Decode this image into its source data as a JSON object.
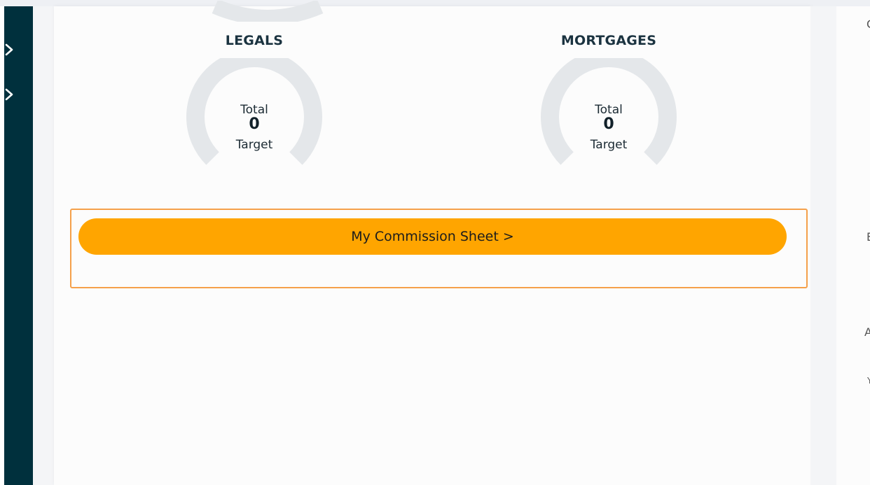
{
  "sidebar": {
    "items": [
      {
        "icon": "chevron-right-icon"
      },
      {
        "icon": "chevron-right-icon"
      }
    ]
  },
  "gauges": [
    {
      "title": "LEGALS",
      "total_label": "Total",
      "value": "0",
      "target_label": "Target",
      "progress": 0
    },
    {
      "title": "MORTGAGES",
      "total_label": "Total",
      "value": "0",
      "target_label": "Target",
      "progress": 0
    }
  ],
  "commission_button": {
    "label": "My Commission Sheet >"
  },
  "right_panel": {
    "letters": [
      "C",
      "E",
      "A",
      "Y"
    ]
  },
  "colors": {
    "sidebar": "#00303d",
    "button": "#ffa500",
    "highlight_border": "#f5a04a",
    "gauge_track": "#e4e7ea"
  }
}
